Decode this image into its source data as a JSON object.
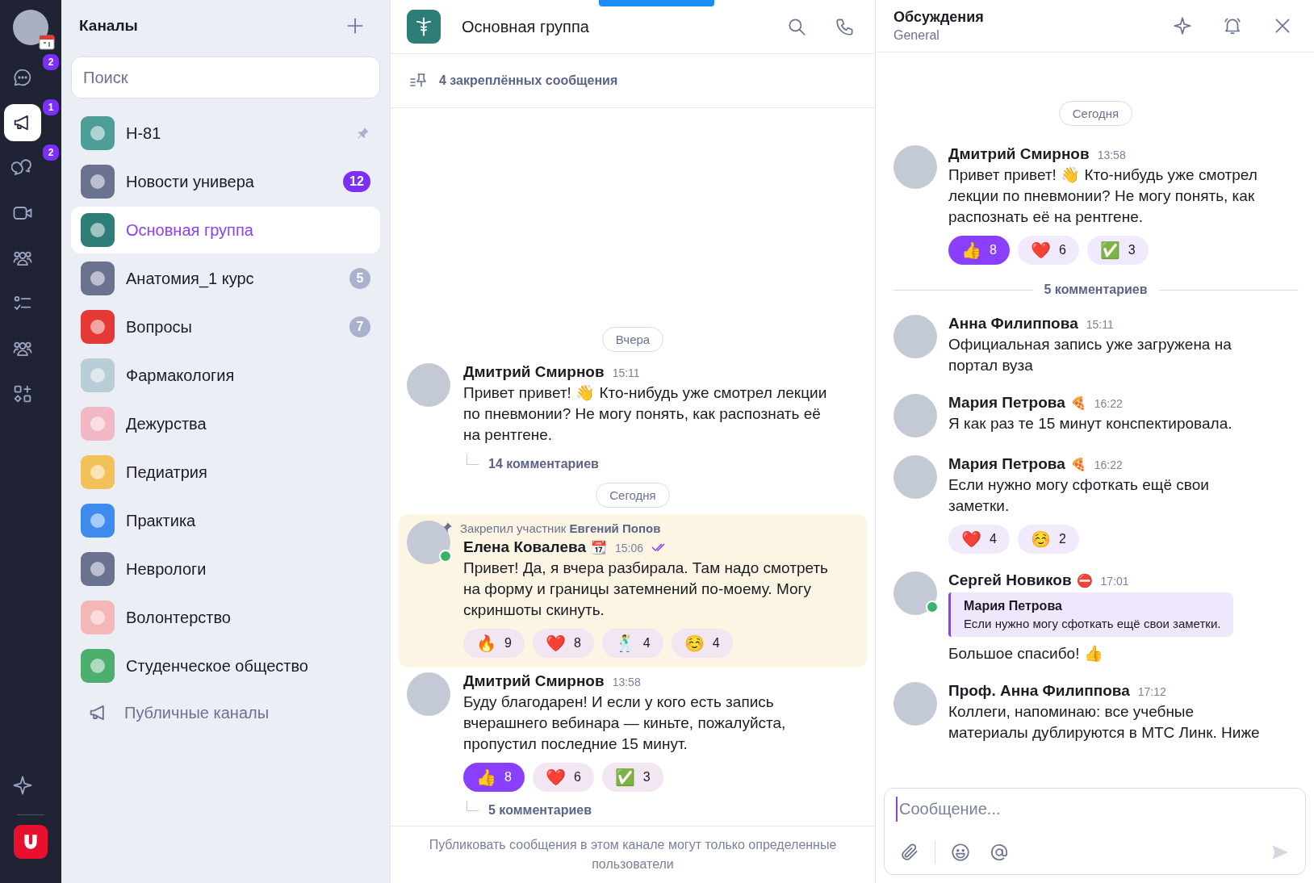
{
  "rail": {
    "items": [
      {
        "badge": "2",
        "selected": false
      },
      {
        "badge": "1",
        "selected": true
      },
      {
        "badge": "2",
        "selected": false
      },
      {
        "selected": false
      },
      {
        "selected": false
      },
      {
        "selected": false
      },
      {
        "selected": false
      },
      {
        "selected": false
      }
    ],
    "bottom": [
      {
        "selected": false
      }
    ]
  },
  "channels": {
    "title": "Каналы",
    "search": {
      "placeholder": "Поиск"
    },
    "items": [
      {
        "name": "Н-81",
        "color": "#4e9e98",
        "pinned": true,
        "selected": false
      },
      {
        "name": "Новости универа",
        "color": "#6b7290",
        "badge": "12",
        "muted": false,
        "pinned": false,
        "selected": false
      },
      {
        "name": "Основная группа",
        "color": "#2e7d77",
        "pinned": false,
        "selected": true
      },
      {
        "name": "Анатомия_1 курс",
        "color": "#6b7290",
        "badge": "5",
        "muted": true,
        "pinned": false,
        "selected": false
      },
      {
        "name": "Вопросы",
        "color": "#e53935",
        "badge": "7",
        "muted": true,
        "pinned": false,
        "selected": false
      },
      {
        "name": "Фармакология",
        "color": "#b9cdd6",
        "pinned": false,
        "selected": false
      },
      {
        "name": "Дежурства",
        "color": "#f2b8c6",
        "pinned": false,
        "selected": false
      },
      {
        "name": "Педиатрия",
        "color": "#f3c15a",
        "pinned": false,
        "selected": false
      },
      {
        "name": "Практика",
        "color": "#3d8bec",
        "pinned": false,
        "selected": false
      },
      {
        "name": "Неврологи",
        "color": "#6b7290",
        "pinned": false,
        "selected": false
      },
      {
        "name": "Волонтерство",
        "color": "#f4b6b6",
        "pinned": false,
        "selected": false
      },
      {
        "name": "Студенческое общество",
        "color": "#4caf6e",
        "pinned": false,
        "selected": false
      }
    ],
    "public_link": "Публичные каналы"
  },
  "chat": {
    "title": "Основная группа",
    "pinned_bar": "4 закреплённых сообщения",
    "feed": [
      {
        "kind": "date",
        "text": "Вчера"
      },
      {
        "kind": "message",
        "author": "Дмитрий Смирнов",
        "time": "15:11",
        "text": "Привет привет! 👋 Кто-нибудь уже смотрел лекции по пневмонии? Не могу понять, как распознать её на рентгене.",
        "comments": "14 комментариев",
        "online": false,
        "pinned": false
      },
      {
        "kind": "date",
        "text": "Сегодня"
      },
      {
        "kind": "message",
        "pinned": true,
        "pin_note": "Закрепил участник **Евгений Попов**",
        "author": "Елена Ковалева",
        "status_emoji": "📆",
        "time": "15:06",
        "read": true,
        "online": true,
        "text": "Привет! Да, я вчера разбирала. Там надо смотреть на форму и границы затемнений по-моему. Могу скриншоты скинуть.",
        "reactions": [
          {
            "emoji": "🔥",
            "count": "9",
            "selected": false
          },
          {
            "emoji": "❤️",
            "count": "8",
            "selected": false
          },
          {
            "emoji": "🕺",
            "count": "4",
            "selected": false
          },
          {
            "emoji": "☺️",
            "count": "4",
            "selected": false
          }
        ]
      },
      {
        "kind": "message",
        "author": "Дмитрий Смирнов",
        "time": "13:58",
        "online": false,
        "pinned": false,
        "text": "Буду благодарен! И если у кого есть запись вчерашнего вебинара — киньте, пожалуйста, пропустил последние 15 минут.",
        "reactions": [
          {
            "emoji": "👍",
            "count": "8",
            "selected": true
          },
          {
            "emoji": "❤️",
            "count": "6",
            "selected": false
          },
          {
            "emoji": "✅",
            "count": "3",
            "selected": false
          }
        ],
        "comments": "5 комментариев"
      }
    ],
    "footer": "Публиковать сообщения в этом канале могут только определенные пользователи"
  },
  "thread": {
    "title": "Обсуждения",
    "subtitle": "General",
    "date": "Сегодня",
    "root": {
      "author": "Дмитрий Смирнов",
      "time": "13:58",
      "online": false,
      "text": "Привет привет! 👋 Кто-нибудь уже смотрел лекции по пневмонии? Не могу понять, как распознать её на рентгене.",
      "reactions": [
        {
          "emoji": "👍",
          "count": "8",
          "selected": true
        },
        {
          "emoji": "❤️",
          "count": "6",
          "selected": false
        },
        {
          "emoji": "✅",
          "count": "3",
          "selected": false
        }
      ]
    },
    "comments_label": "5 комментариев",
    "comments": [
      {
        "author": "Анна Филиппова",
        "time": "15:11",
        "online": false,
        "text": "Официальная запись уже загружена на портал вуза"
      },
      {
        "author": "Мария Петрова",
        "status_emoji": "🍕",
        "time": "16:22",
        "online": false,
        "text": "Я как раз те 15 минут конспектировала."
      },
      {
        "author": "Мария Петрова",
        "status_emoji": "🍕",
        "time": "16:22",
        "online": false,
        "text": "Если нужно могу сфоткать ещё свои заметки.",
        "reactions": [
          {
            "emoji": "❤️",
            "count": "4",
            "selected": false
          },
          {
            "emoji": "☺️",
            "count": "2",
            "selected": false
          }
        ]
      },
      {
        "author": "Сергей Новиков",
        "status_emoji": "⛔",
        "time": "17:01",
        "online": true,
        "quote": {
          "author": "Мария Петрова",
          "text": "Если нужно могу сфоткать ещё свои заметки."
        },
        "text": "Большое спасибо! 👍"
      },
      {
        "author": "Проф. Анна Филиппова",
        "time": "17:12",
        "online": false,
        "text": "Коллеги, напоминаю: все учебные материалы дублируются в МТС Линк. Ниже"
      }
    ],
    "composer": {
      "placeholder": "Сообщение..."
    }
  }
}
